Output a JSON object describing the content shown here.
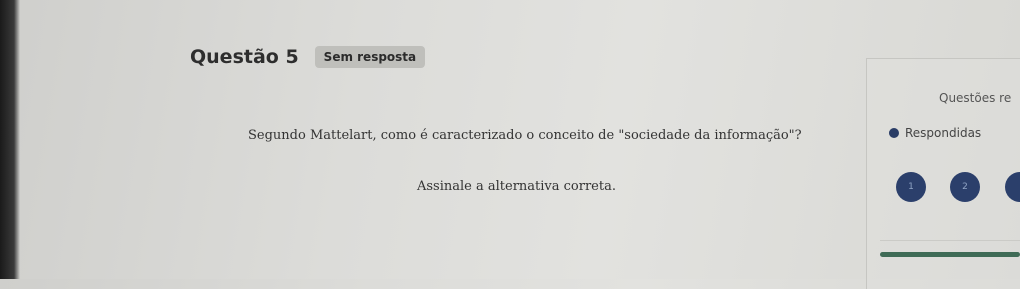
{
  "question": {
    "title": "Questão 5",
    "status_badge": "Sem resposta",
    "text": "Segundo Mattelart, como é caracterizado o conceito de \"sociedade da informação\"?",
    "instruction": "Assinale a alternativa correta."
  },
  "side_panel": {
    "title": "Questões re",
    "legend_label": "Respondidas",
    "legend_color": "#2a3d66",
    "question_buttons": [
      "1",
      "2",
      ""
    ],
    "progress": 1.0
  }
}
